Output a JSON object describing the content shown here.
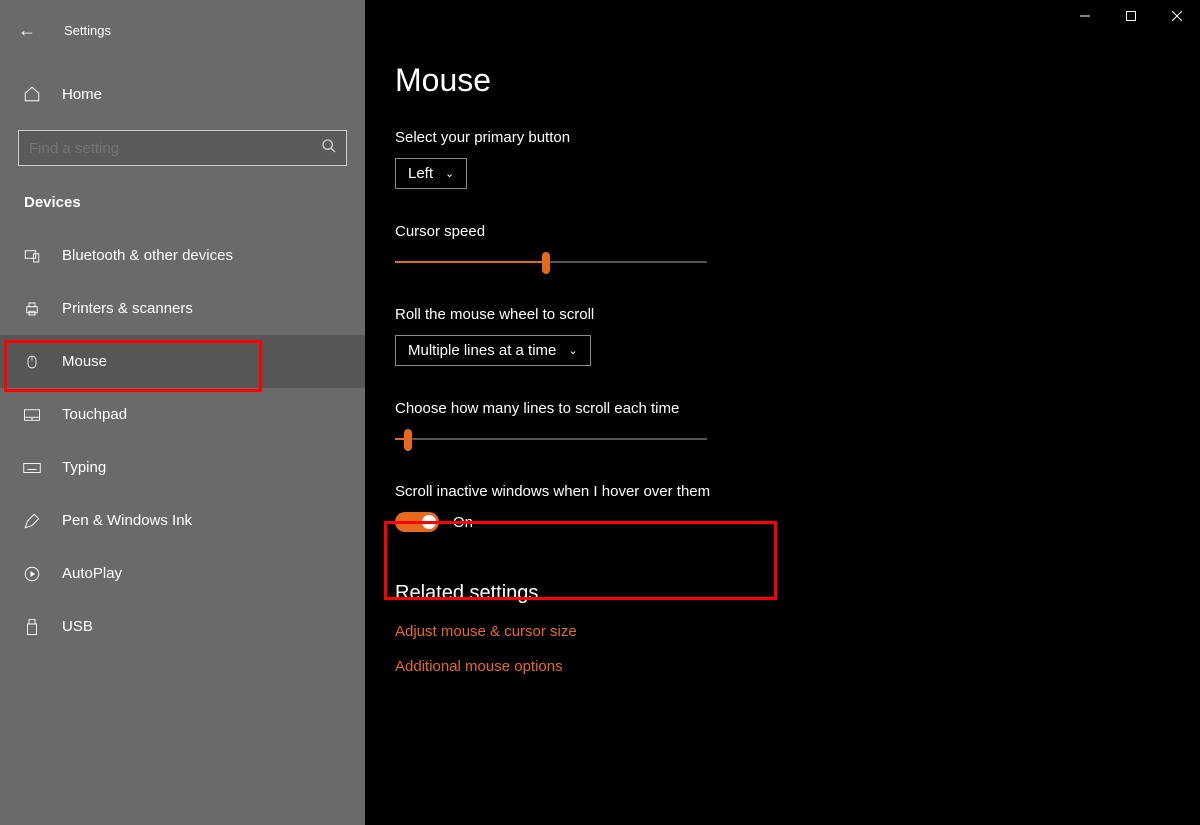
{
  "titlebar": {
    "app": "Settings"
  },
  "sidebar": {
    "home": "Home",
    "search_placeholder": "Find a setting",
    "category": "Devices",
    "items": [
      {
        "label": "Bluetooth & other devices"
      },
      {
        "label": "Printers & scanners"
      },
      {
        "label": "Mouse"
      },
      {
        "label": "Touchpad"
      },
      {
        "label": "Typing"
      },
      {
        "label": "Pen & Windows Ink"
      },
      {
        "label": "AutoPlay"
      },
      {
        "label": "USB"
      }
    ]
  },
  "main": {
    "title": "Mouse",
    "primary_label": "Select your primary button",
    "primary_value": "Left",
    "cursor_label": "Cursor speed",
    "cursor_percent": 47,
    "roll_label": "Roll the mouse wheel to scroll",
    "roll_value": "Multiple lines at a time",
    "lines_label": "Choose how many lines to scroll each time",
    "lines_percent": 3,
    "scroll_inactive_label": "Scroll inactive windows when I hover over them",
    "scroll_inactive_state": "On",
    "related_heading": "Related settings",
    "link_adjust": "Adjust mouse & cursor size",
    "link_additional": "Additional mouse options"
  }
}
